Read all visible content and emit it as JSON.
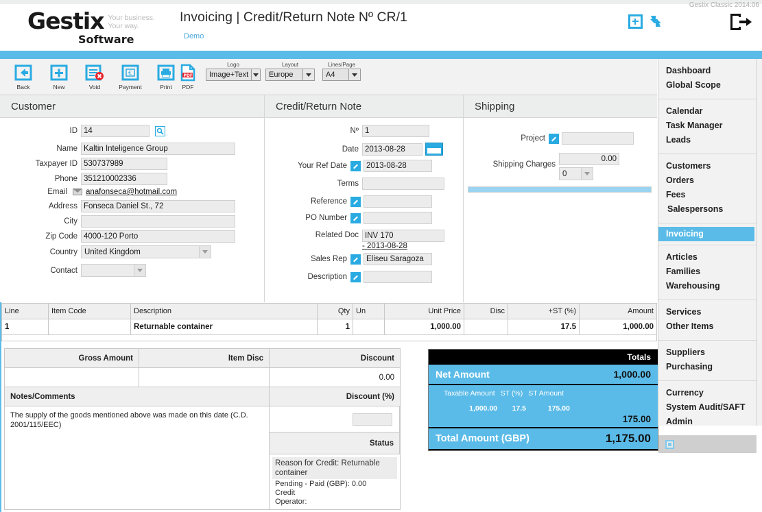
{
  "app": {
    "logo_main": "Gestix",
    "logo_sub": "Software",
    "tagline_line1": "Your business.",
    "tagline_line2": "Your way.",
    "page_title": "Invoicing | Credit/Return Note Nº CR/1",
    "demo_link": "Demo",
    "version": "Gestix Classic 2014.06",
    "accent_blue": "#5bbbe8",
    "icon_blue": "#29abe2",
    "header_icons": [
      {
        "name": "add-box-icon"
      },
      {
        "name": "refresh-sync-icon"
      },
      {
        "name": "logout-icon"
      }
    ]
  },
  "toolbar": {
    "buttons": [
      {
        "label": "Back",
        "icon": "back-arrow-icon"
      },
      {
        "label": "New",
        "icon": "plus-icon"
      },
      {
        "label": "Void",
        "icon": "void-document-icon"
      },
      {
        "label": "Payment",
        "icon": "payment-card-icon"
      },
      {
        "label": "Print",
        "icon": "printer-icon"
      },
      {
        "label": "PDF",
        "icon": "pdf-file-icon"
      }
    ],
    "selects": [
      {
        "label": "Logo",
        "value": "Image+Text"
      },
      {
        "label": "Layout",
        "value": "Europe"
      },
      {
        "label": "Lines/Page",
        "value": "A4"
      }
    ]
  },
  "customer": {
    "title": "Customer",
    "id_label": "ID",
    "id_value": "14",
    "search_icon": "search-icon",
    "fields": [
      {
        "label": "Name",
        "value": "Kaltin Inteligence Group"
      },
      {
        "label": "Taxpayer ID",
        "value": "530737989"
      },
      {
        "label": "Phone",
        "value": "351210002336"
      }
    ],
    "email_label": "Email",
    "email_value": "anafonseca@hotmail.com",
    "address_label": "Address",
    "address_value": "Fonseca Daniel St., 72",
    "city_label": "City",
    "city_value": "",
    "zip_label": "Zip Code",
    "zip_value": "4000-120 Porto",
    "country_label": "Country",
    "country_value": "United Kingdom",
    "contact_label": "Contact",
    "contact_value": ""
  },
  "note": {
    "title": "Credit/Return Note",
    "no_label": "Nº",
    "no_value": "1",
    "date_label": "Date",
    "date_value": "2013-08-28",
    "your_ref_date_label": "Your Ref Date",
    "your_ref_date_value": "2013-08-28",
    "terms_label": "Terms",
    "terms_value": "",
    "reference_label": "Reference",
    "reference_value": "",
    "po_number_label": "PO Number",
    "po_number_value": "",
    "related_doc_label": "Related Doc",
    "related_doc_value": "INV 170",
    "related_doc_date": "- 2013-08-28",
    "sales_rep_label": "Sales Rep",
    "sales_rep_value": "Eliseu Saragoza",
    "description_label": "Description",
    "description_value": ""
  },
  "shipping": {
    "title": "Shipping",
    "project_label": "Project",
    "project_value": "",
    "charges_label": "Shipping Charges",
    "charges_value": "0.00",
    "charges_select_value": "0"
  },
  "items": {
    "columns": [
      "Line",
      "Item Code",
      "Description",
      "Qty",
      "Un",
      "Unit Price",
      "Disc",
      "+ST (%)",
      "Amount"
    ],
    "rows": [
      {
        "line": "1",
        "item_code": "",
        "description": "Returnable container",
        "qty": "1",
        "un": "",
        "unit_price": "1,000.00",
        "disc": "",
        "st_pct": "17.5",
        "amount": "1,000.00"
      }
    ]
  },
  "summary": {
    "gross_amount_label": "Gross Amount",
    "gross_amount_value": "",
    "item_disc_label": "Item Disc",
    "item_disc_value": "",
    "discount_label": "Discount",
    "discount_value": "0.00",
    "notes_label": "Notes/Comments",
    "notes_value": "The supply of the goods mentioned above was made on this date (C.D. 2001/115/EEC)",
    "discount_pct_label": "Discount (%)",
    "discount_pct_value": "",
    "status_label": "Status",
    "status_highlight": "Reason for Credit: Returnable container",
    "status_line1": "Pending - Paid (GBP): 0.00",
    "status_line2": "Credit",
    "status_line3": "Operator:"
  },
  "totals": {
    "header": "Totals",
    "net_label": "Net Amount",
    "net_value": "1,000.00",
    "tax_col1": "Taxable Amount",
    "tax_col2": "ST (%)",
    "tax_col3": "ST Amount",
    "tax_val1": "1,000.00",
    "tax_val2": "17.5",
    "tax_val3": "175.00",
    "tax_total": "175.00",
    "grand_label": "Total Amount (GBP)",
    "grand_value": "1,175.00"
  },
  "sidebar": {
    "groups": [
      {
        "items": [
          {
            "label": "Dashboard"
          },
          {
            "label": "Global Scope"
          }
        ]
      },
      {
        "items": [
          {
            "label": "Calendar"
          },
          {
            "label": "Task Manager"
          },
          {
            "label": "Leads"
          }
        ]
      },
      {
        "items": [
          {
            "label": "Customers"
          },
          {
            "label": "Orders"
          },
          {
            "label": "Fees"
          },
          {
            "label": "Salespersons"
          }
        ]
      },
      {
        "items": [
          {
            "label": "Invoicing",
            "active": true
          }
        ]
      },
      {
        "items": [
          {
            "label": "Articles"
          },
          {
            "label": "Families"
          },
          {
            "label": "Warehousing"
          }
        ]
      },
      {
        "items": [
          {
            "label": "Services"
          },
          {
            "label": "Other Items"
          }
        ]
      },
      {
        "items": [
          {
            "label": "Suppliers"
          },
          {
            "label": "Purchasing"
          }
        ]
      },
      {
        "items": [
          {
            "label": "Currency"
          },
          {
            "label": "System Audit/SAFT"
          },
          {
            "label": "Admin"
          }
        ]
      }
    ],
    "footer_icon": "panel-toggle-icon"
  }
}
